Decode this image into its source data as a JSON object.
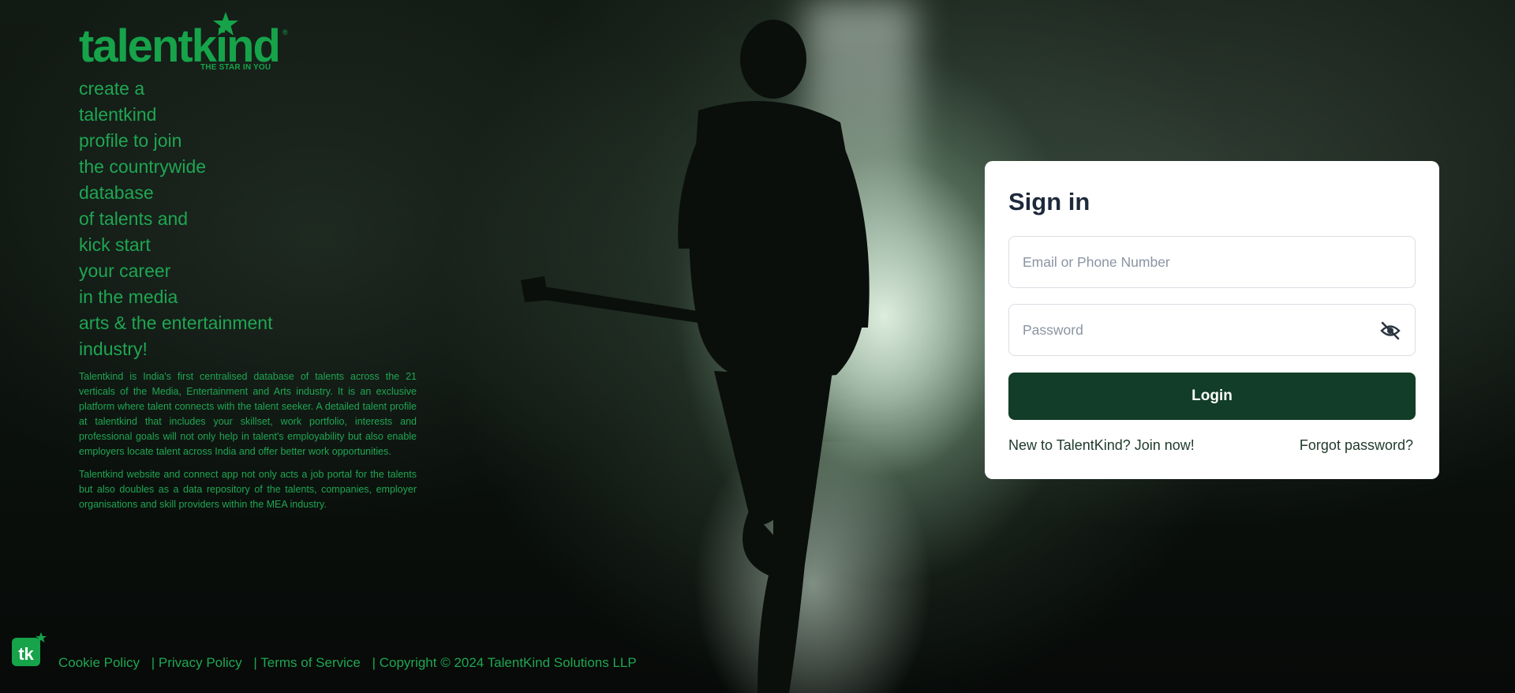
{
  "brand": {
    "wordmark": "talentkind",
    "registered": "®",
    "tagline": "THE STAR IN YOU",
    "badge_text": "tk"
  },
  "headline": {
    "lines": [
      "create a",
      "talentkind",
      "profile to join",
      "the countrywide",
      "database",
      "of talents and",
      "kick start",
      "your career",
      "in the media",
      "arts & the entertainment",
      "industry!"
    ]
  },
  "description": {
    "paragraphs": [
      "Talentkind is India's first centralised database of talents across the 21 verticals of the Media, Entertainment and Arts industry. It is an exclusive platform where talent connects with the talent seeker. A detailed talent profile at talentkind that includes your skillset, work portfolio, interests and professional goals will not only help in talent's employability but also enable employers locate talent across India and offer better work opportunities.",
      "Talentkind website and connect app not only acts a job portal for the talents but also doubles as a data repository of the talents, companies, employer organisations and skill providers within the MEA industry."
    ]
  },
  "signin": {
    "title": "Sign in",
    "email_placeholder": "Email or Phone Number",
    "email_value": "",
    "password_placeholder": "Password",
    "password_value": "",
    "login_label": "Login",
    "join_link": "New to TalentKind? Join now!",
    "forgot_link": "Forgot password?",
    "password_toggle_icon": "eye-off-icon"
  },
  "footer": {
    "cookie": "Cookie Policy",
    "privacy": "| Privacy Policy",
    "terms": "| Terms of Service",
    "copyright": "| Copyright © 2024 TalentKind Solutions LLP"
  },
  "colors": {
    "brand_green": "#16a34a",
    "text_green": "#1fa652",
    "button_dark_green": "#123d28",
    "card_bg": "#ffffff",
    "title_text": "#1e293b"
  }
}
